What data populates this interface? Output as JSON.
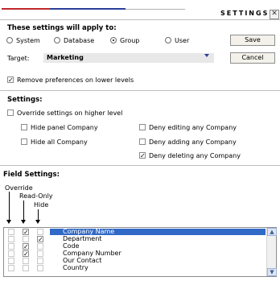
{
  "header": {
    "title": "SETTINGS",
    "close_glyph": "✕"
  },
  "scope": {
    "heading": "These settings will apply to:",
    "options": [
      "System",
      "Database",
      "Group",
      "User"
    ],
    "selected": "Group",
    "target_label": "Target:",
    "target_value": "Marketing",
    "remove_prefs_label": "Remove preferences on lower levels",
    "remove_prefs_checked": true,
    "save_label": "Save",
    "cancel_label": "Cancel"
  },
  "settings": {
    "heading": "Settings:",
    "override_label": "Override settings on higher level",
    "override_checked": false,
    "items": [
      {
        "label": "Hide panel Company",
        "checked": false
      },
      {
        "label": "Hide all Company",
        "checked": false
      },
      {
        "label": "Deny editing any Company",
        "checked": false
      },
      {
        "label": "Deny adding any Company",
        "checked": false
      },
      {
        "label": "Deny deleting any Company",
        "checked": true
      }
    ]
  },
  "field_settings": {
    "heading": "Field Settings:",
    "col_override": "Override",
    "col_readonly": "Read-Only",
    "col_hide": "Hide",
    "rows": [
      {
        "name": "Company Name",
        "override": false,
        "readonly": true,
        "hide": false,
        "selected": true
      },
      {
        "name": "Department",
        "override": false,
        "readonly": false,
        "hide": true,
        "selected": false
      },
      {
        "name": "Code",
        "override": false,
        "readonly": true,
        "hide": false,
        "selected": false
      },
      {
        "name": "Company Number",
        "override": false,
        "readonly": true,
        "hide": false,
        "selected": false
      },
      {
        "name": "Our Contact",
        "override": false,
        "readonly": false,
        "hide": false,
        "selected": false
      },
      {
        "name": "Country",
        "override": false,
        "readonly": false,
        "hide": false,
        "selected": false
      }
    ]
  },
  "colors": {
    "accent_red": "#c0292b",
    "accent_blue": "#2a3f9a",
    "selection": "#3169c6"
  }
}
